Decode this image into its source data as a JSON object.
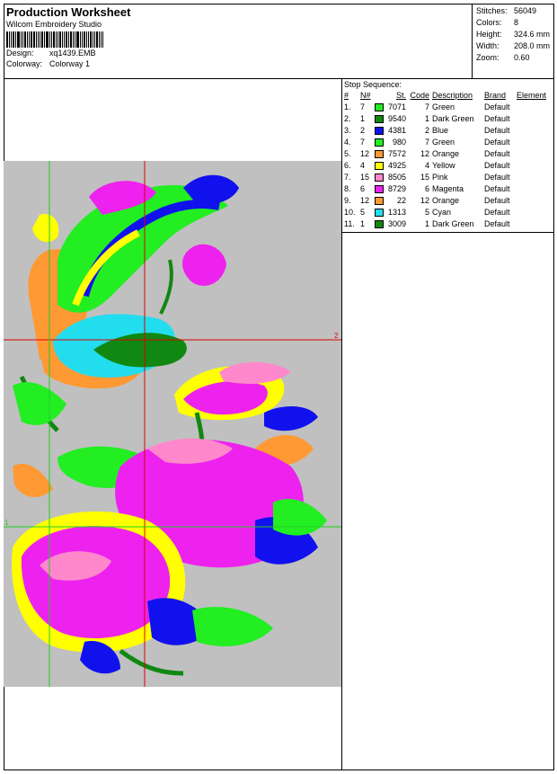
{
  "header": {
    "title": "Production Worksheet",
    "software": "Wilcom  Embroidery Studio",
    "design_label": "Design:",
    "design_value": "xq1439.EMB",
    "colorway_label": "Colorway:",
    "colorway_value": "Colorway 1"
  },
  "stats": {
    "stitches_label": "Stitches:",
    "stitches_value": "56049",
    "colors_label": "Colors:",
    "colors_value": "8",
    "height_label": "Height:",
    "height_value": "324.6 mm",
    "width_label": "Width:",
    "width_value": "208.0 mm",
    "zoom_label": "Zoom:",
    "zoom_value": "0.60"
  },
  "stop_sequence": {
    "title": "Stop Sequence:",
    "headers": [
      "#",
      "N#",
      "St.",
      "Code",
      "Description",
      "Brand",
      "Element"
    ],
    "rows": [
      {
        "idx": "1.",
        "n": "7",
        "color": "#22ee22",
        "st": "7071",
        "code": "7",
        "desc": "Green",
        "brand": "Default"
      },
      {
        "idx": "2.",
        "n": "1",
        "color": "#118811",
        "st": "9540",
        "code": "1",
        "desc": "Dark Green",
        "brand": "Default"
      },
      {
        "idx": "3.",
        "n": "2",
        "color": "#1111ee",
        "st": "4381",
        "code": "2",
        "desc": "Blue",
        "brand": "Default"
      },
      {
        "idx": "4.",
        "n": "7",
        "color": "#22ee22",
        "st": "980",
        "code": "7",
        "desc": "Green",
        "brand": "Default"
      },
      {
        "idx": "5.",
        "n": "12",
        "color": "#ff9933",
        "st": "7572",
        "code": "12",
        "desc": "Orange",
        "brand": "Default"
      },
      {
        "idx": "6.",
        "n": "4",
        "color": "#ffff00",
        "st": "4925",
        "code": "4",
        "desc": "Yellow",
        "brand": "Default"
      },
      {
        "idx": "7.",
        "n": "15",
        "color": "#ff88cc",
        "st": "8505",
        "code": "15",
        "desc": "Pink",
        "brand": "Default"
      },
      {
        "idx": "8.",
        "n": "6",
        "color": "#ee22ee",
        "st": "8729",
        "code": "6",
        "desc": "Magenta",
        "brand": "Default"
      },
      {
        "idx": "9.",
        "n": "12",
        "color": "#ff9933",
        "st": "22",
        "code": "12",
        "desc": "Orange",
        "brand": "Default"
      },
      {
        "idx": "10.",
        "n": "5",
        "color": "#22ddee",
        "st": "1313",
        "code": "5",
        "desc": "Cyan",
        "brand": "Default"
      },
      {
        "idx": "11.",
        "n": "1",
        "color": "#118811",
        "st": "3009",
        "code": "1",
        "desc": "Dark Green",
        "brand": "Default"
      }
    ]
  },
  "design_area": {
    "background": "#c0c0c0",
    "crosshair_colors": {
      "vertical_right": "#dd0000",
      "horizontal_top": "#dd0000",
      "vertical_left": "#22cc22",
      "horizontal_bottom": "#22cc22"
    },
    "marker_right": "2",
    "marker_left": "1"
  }
}
